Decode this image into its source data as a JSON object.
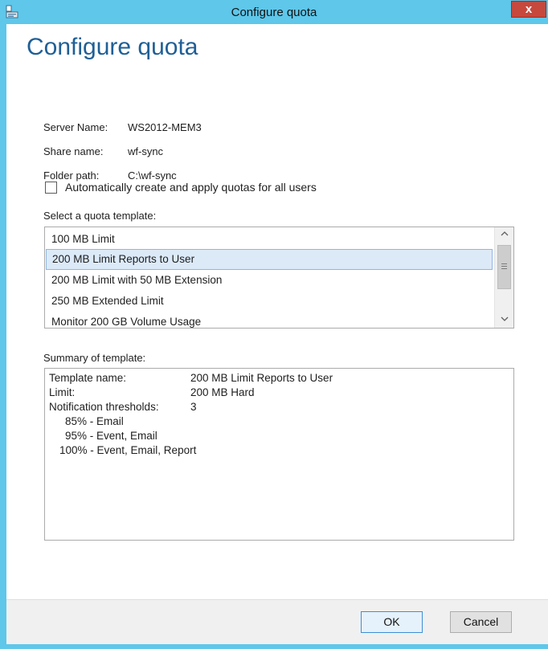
{
  "window": {
    "title": "Configure quota",
    "close_label": "x"
  },
  "heading": "Configure quota",
  "info": [
    {
      "label": "Server Name:",
      "value": "WS2012-MEM3"
    },
    {
      "label": "Share name:",
      "value": "wf-sync"
    },
    {
      "label": "Folder path:",
      "value": "C:\\wf-sync"
    }
  ],
  "auto_quota": {
    "label": "Automatically create and apply quotas for all users",
    "checked": false
  },
  "template_section": {
    "label": "Select a quota template:",
    "items": [
      "100 MB Limit",
      "200 MB Limit Reports to User",
      "200 MB Limit with 50 MB Extension",
      "250 MB Extended Limit",
      "Monitor 200 GB Volume Usage"
    ],
    "selected_index": 1
  },
  "summary": {
    "label": "Summary of template:",
    "template_name_key": "Template name:",
    "template_name_value": "200 MB Limit Reports to User",
    "limit_key": "Limit:",
    "limit_value": "200 MB Hard",
    "thresholds_key": "Notification thresholds:",
    "thresholds_value": "3",
    "thresholds": [
      "85% - Email",
      "95% - Event, Email",
      "100% - Event, Email, Report"
    ]
  },
  "buttons": {
    "ok": "OK",
    "cancel": "Cancel"
  },
  "colors": {
    "frame": "#5ec7ea",
    "heading": "#1f5f96",
    "selection": "#dceaf8",
    "close": "#c7483d"
  }
}
